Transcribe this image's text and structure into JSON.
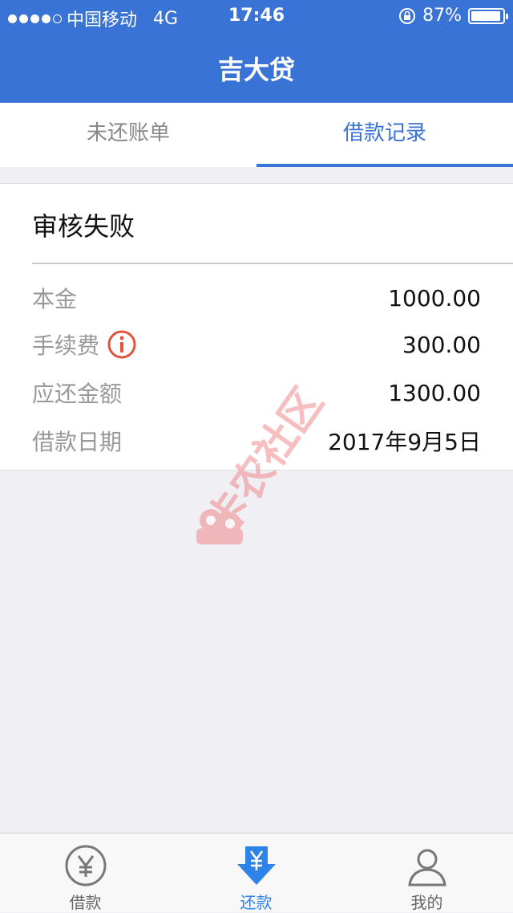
{
  "status_bar": {
    "carrier": "中国移动",
    "network": "4G",
    "time": "17:46",
    "battery": "87%"
  },
  "header": {
    "title": "吉大贷"
  },
  "tabs": [
    {
      "label": "未还账单",
      "active": false
    },
    {
      "label": "借款记录",
      "active": true
    }
  ],
  "record": {
    "status": "审核失败",
    "rows": [
      {
        "label": "本金",
        "value": "1000.00"
      },
      {
        "label": "手续费",
        "value": "300.00"
      },
      {
        "label": "应还金额",
        "value": "1300.00"
      },
      {
        "label": "借款日期",
        "value": "2017年9月5日"
      }
    ]
  },
  "watermark": {
    "text": "卡农社区"
  },
  "tabbar": {
    "items": [
      {
        "label": "借款",
        "icon": "yen-circle-icon"
      },
      {
        "label": "还款",
        "icon": "yen-download-icon",
        "active": true
      },
      {
        "label": "我的",
        "icon": "person-icon"
      }
    ]
  },
  "colors": {
    "primary": "#3a73d6",
    "tab_active": "#2d83e8",
    "warning": "#e0533c",
    "watermark": "#f08a8a"
  }
}
